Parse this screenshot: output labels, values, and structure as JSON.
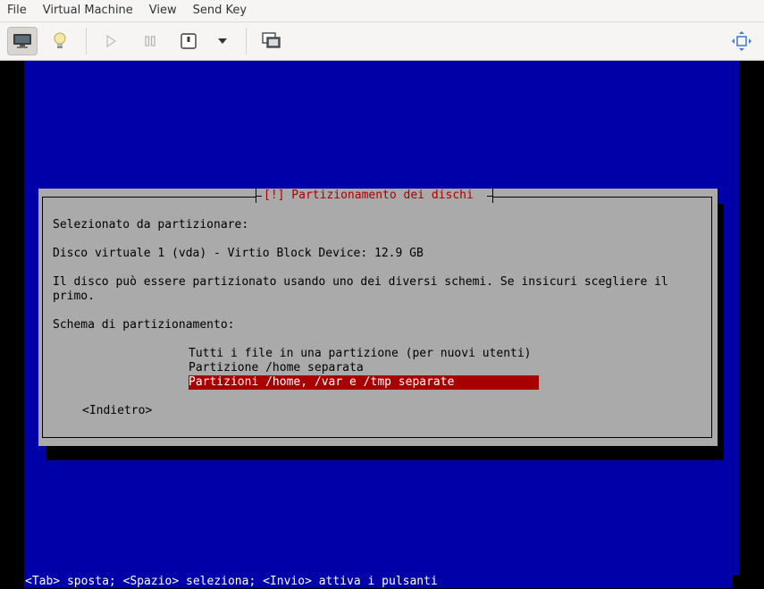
{
  "menubar": {
    "items": [
      "File",
      "Virtual Machine",
      "View",
      "Send Key"
    ]
  },
  "toolbar": {
    "buttons": [
      {
        "name": "console-view",
        "icon": "monitor-icon",
        "active": true
      },
      {
        "name": "details-view",
        "icon": "lightbulb-icon"
      },
      {
        "name": "run",
        "icon": "play-icon"
      },
      {
        "name": "pause",
        "icon": "pause-icon"
      },
      {
        "name": "shutdown",
        "icon": "power-icon"
      },
      {
        "name": "shutdown-menu",
        "icon": "chevron-down-icon"
      },
      {
        "name": "snapshots",
        "icon": "snapshots-icon"
      },
      {
        "name": "fullscreen",
        "icon": "resize-icon"
      }
    ]
  },
  "installer": {
    "dialog_title": "[!] Partizionamento dei dischi",
    "lines": {
      "selected_label": "Selezionato da partizionare:",
      "disk": "Disco virtuale 1 (vda) - Virtio Block Device: 12.9 GB",
      "desc1": "Il disco può essere partizionato usando uno dei diversi schemi. Se insicuri scegliere il",
      "desc2": "primo.",
      "scheme_label": "Schema di partizionamento:"
    },
    "choices": [
      "Tutti i file in una partizione (per nuovi utenti)",
      "Partizione /home separata",
      "Partizioni /home, /var e /tmp separate"
    ],
    "selected_choice_index": 2,
    "back_button": "<Indietro>",
    "status_line": "<Tab> sposta; <Spazio> seleziona; <Invio> attiva i pulsanti"
  },
  "colors": {
    "screen_bg": "#0000a8",
    "dialog_bg": "#aaaaaa",
    "title_text": "#a80000",
    "selection_bg": "#a80000",
    "selection_text": "#ffffff"
  }
}
